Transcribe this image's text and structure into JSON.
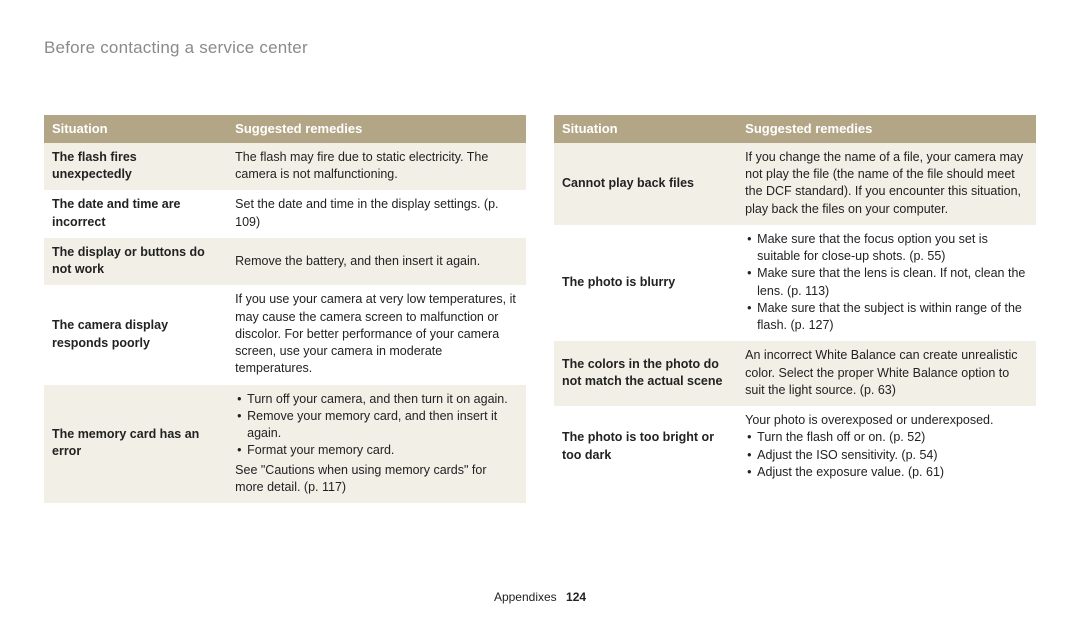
{
  "title": "Before contacting a service center",
  "headers": {
    "situation": "Situation",
    "remedies": "Suggested remedies"
  },
  "left": [
    {
      "sit": "The flash fires unexpectedly",
      "rem_text": "The flash may fire due to static electricity. The camera is not malfunctioning."
    },
    {
      "sit": "The date and time are incorrect",
      "rem_text": "Set the date and time in the display settings. (p. 109)"
    },
    {
      "sit": "The display or buttons do not work",
      "rem_text": "Remove the battery, and then insert it again."
    },
    {
      "sit": "The camera display responds poorly",
      "rem_text": "If you use your camera at very low temperatures, it may cause the camera screen to malfunction or discolor. For better performance of your camera screen, use your camera in moderate temperatures."
    },
    {
      "sit": "The memory card has an error",
      "rem_bullets": [
        "Turn off your camera, and then turn it on again.",
        "Remove your memory card, and then insert it again.",
        "Format your memory card."
      ],
      "rem_after": "See \"Cautions when using memory cards\" for more detail. (p. 117)"
    }
  ],
  "right": [
    {
      "sit": "Cannot play back files",
      "rem_text": "If you change the name of a file, your camera may not play the file (the name of the file should meet the DCF standard). If you encounter this situation, play back the files on your computer."
    },
    {
      "sit": "The photo is blurry",
      "rem_bullets": [
        "Make sure that the focus option you set is suitable for close-up shots. (p. 55)",
        "Make sure that the lens is clean. If not, clean the lens. (p. 113)",
        "Make sure that the subject is within range of the flash. (p. 127)"
      ]
    },
    {
      "sit": "The colors in the photo do not match the actual scene",
      "rem_text": "An incorrect White Balance can create unrealistic color. Select the proper White Balance option to suit the light source. (p. 63)"
    },
    {
      "sit": "The photo is too bright or too dark",
      "rem_before": "Your photo is overexposed or underexposed.",
      "rem_bullets": [
        "Turn the flash off or on. (p. 52)",
        "Adjust the ISO sensitivity. (p. 54)",
        "Adjust the exposure value. (p. 61)"
      ]
    }
  ],
  "footer": {
    "label": "Appendixes",
    "page": "124"
  }
}
